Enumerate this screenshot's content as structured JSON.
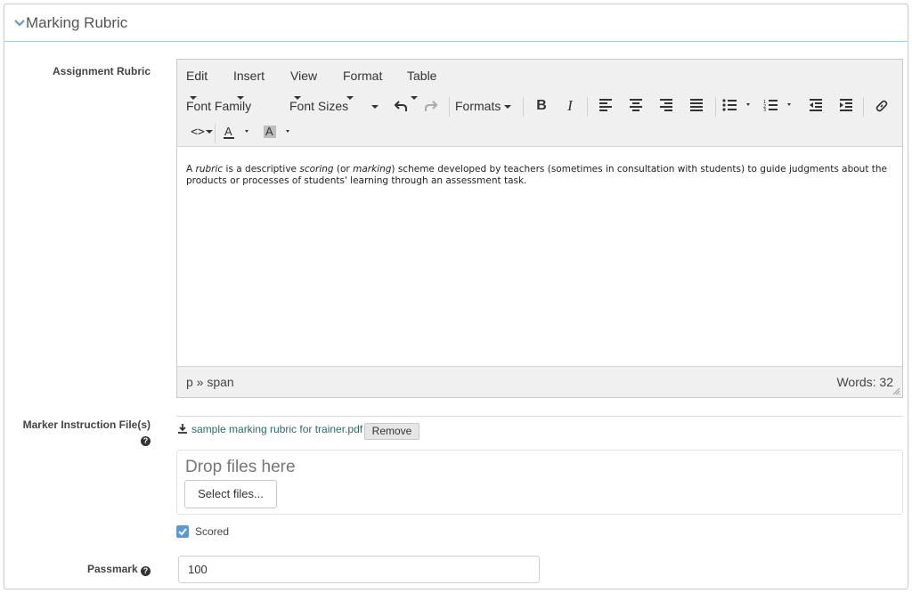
{
  "section": {
    "title": "Marking Rubric"
  },
  "assignment_rubric": {
    "label": "Assignment Rubric",
    "menubar": [
      "Edit",
      "Insert",
      "View",
      "Format",
      "Table"
    ],
    "toolbar": {
      "font_family": "Font Family",
      "font_sizes": "Font Sizes",
      "formats": "Formats"
    },
    "content": {
      "p1": "A ",
      "e1": "rubric",
      "p2": " is a descriptive ",
      "e2": "scoring",
      "p3": " (or ",
      "e3": "marking",
      "p4": ") scheme developed by teachers (sometimes in consultation with students) to guide judgments about the products or processes of students' learning through an assessment task."
    },
    "status_path": "p » span",
    "word_count": "Words: 32"
  },
  "marker_instructions": {
    "label": "Marker Instruction File(s)",
    "file_name": "sample marking rubric for trainer.pdf",
    "remove_label": "Remove",
    "drop_text": "Drop files here",
    "select_label": "Select files..."
  },
  "scored": {
    "label": "Scored",
    "checked": true
  },
  "passmark": {
    "label": "Passmark",
    "value": "100"
  },
  "colors": {
    "accent": "#5b9bd5",
    "file_link": "#2c6b69"
  }
}
